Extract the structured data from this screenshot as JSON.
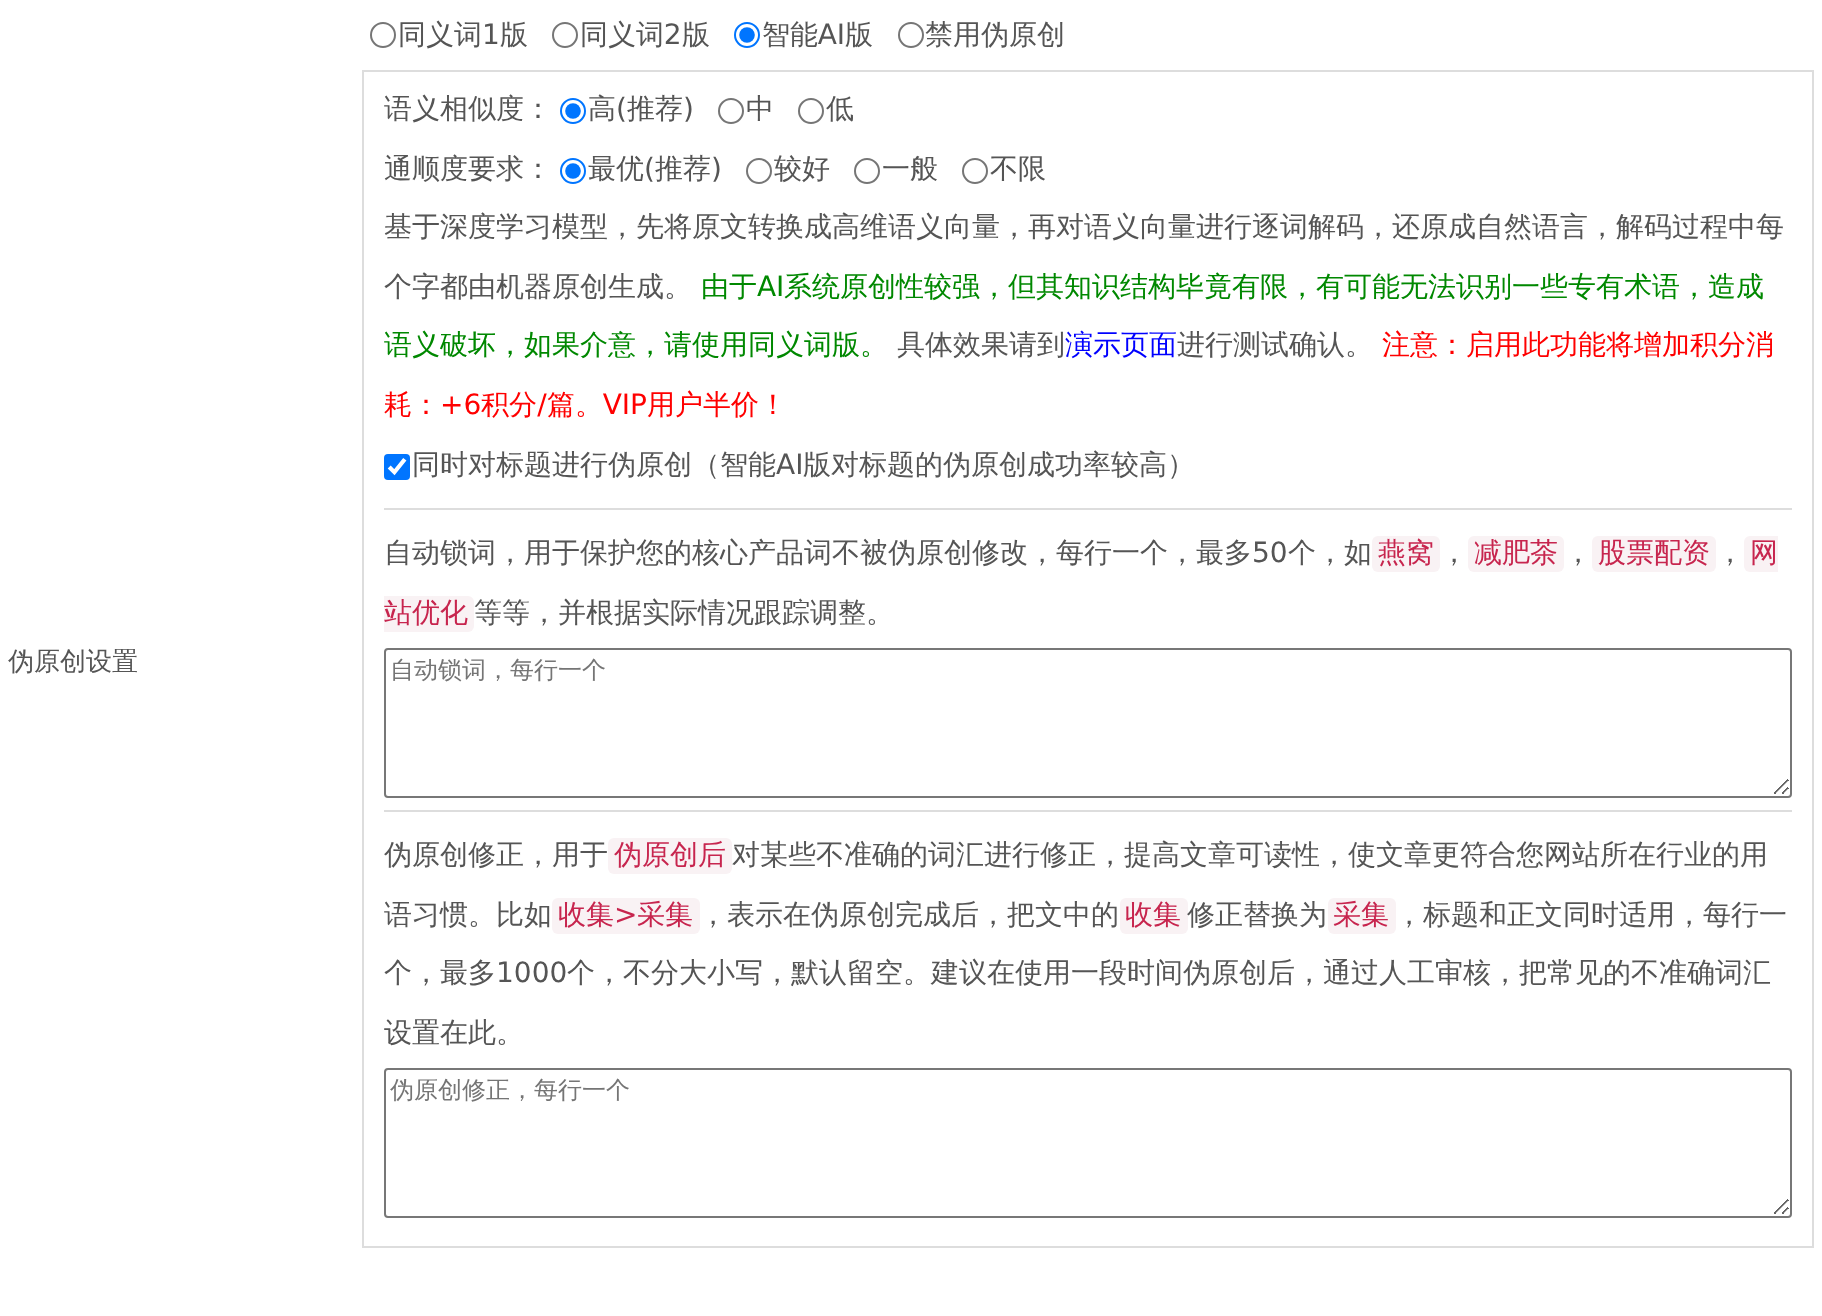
{
  "mode_options": [
    {
      "label": "同义词1版",
      "selected": false
    },
    {
      "label": "同义词2版",
      "selected": false
    },
    {
      "label": "智能AI版",
      "selected": true
    },
    {
      "label": "禁用伪原创",
      "selected": false
    }
  ],
  "settings": [
    {
      "label": "语义相似度：",
      "options": [
        {
          "label": "高(推荐)",
          "selected": true
        },
        {
          "label": "中",
          "selected": false
        },
        {
          "label": "低",
          "selected": false
        }
      ]
    },
    {
      "label": "通顺度要求：",
      "options": [
        {
          "label": "最优(推荐)",
          "selected": true
        },
        {
          "label": "较好",
          "selected": false
        },
        {
          "label": "一般",
          "selected": false
        },
        {
          "label": "不限",
          "selected": false
        }
      ]
    }
  ],
  "description": [
    {
      "kind": "plain",
      "text": "基于深度学习模型，先将原文转换成高维语义向量，再对语义向量进行逐词解码，还原成自然语言，解码过程中每个字都由机器原创生成。 "
    },
    {
      "kind": "green",
      "text": "由于AI系统原创性较强，但其知识结构毕竟有限，有可能无法识别一些专有术语，造成语义破坏，如果介意，请使用同义词版。"
    },
    {
      "kind": "plain",
      "text": " 具体效果请到"
    },
    {
      "kind": "link",
      "text": "演示页面"
    },
    {
      "kind": "plain",
      "text": "进行测试确认。 "
    },
    {
      "kind": "red",
      "text": "注意：启用此功能将增加积分消耗：+6积分/篇。VIP用户半价！"
    }
  ],
  "title_option": {
    "label": "同时对标题进行伪原创（智能AI版对标题的伪原创成功率较高）",
    "checked": true
  },
  "section_label": "伪原创设置",
  "lock_words": {
    "description": [
      {
        "kind": "plain",
        "text": "自动锁词，用于保护您的核心产品词不被伪原创修改，每行一个，最多50个，如"
      },
      {
        "kind": "tag",
        "text": "燕窝"
      },
      {
        "kind": "plain",
        "text": "，"
      },
      {
        "kind": "tag",
        "text": "减肥茶"
      },
      {
        "kind": "plain",
        "text": "，"
      },
      {
        "kind": "tag",
        "text": "股票配资"
      },
      {
        "kind": "plain",
        "text": "，"
      },
      {
        "kind": "tag",
        "text": "网站优化"
      },
      {
        "kind": "plain",
        "text": "等等，并根据实际情况跟踪调整。"
      }
    ],
    "placeholder": "自动锁词，每行一个"
  },
  "corrections": {
    "description": [
      {
        "kind": "plain",
        "text": "伪原创修正，用于"
      },
      {
        "kind": "tag",
        "text": "伪原创后"
      },
      {
        "kind": "plain",
        "text": "对某些不准确的词汇进行修正，提高文章可读性，使文章更符合您网站所在行业的用语习惯。比如"
      },
      {
        "kind": "tag",
        "text": "收集>采集"
      },
      {
        "kind": "plain",
        "text": "，表示在伪原创完成后，把文中的"
      },
      {
        "kind": "tag",
        "text": "收集"
      },
      {
        "kind": "plain",
        "text": "修正替换为"
      },
      {
        "kind": "tag",
        "text": "采集"
      },
      {
        "kind": "plain",
        "text": "，标题和正文同时适用，每行一个，最多1000个，不分大小写，默认留空。建议在使用一段时间伪原创后，通过人工审核，把常见的不准确词汇设置在此。"
      }
    ],
    "placeholder": "伪原创修正，每行一个"
  }
}
